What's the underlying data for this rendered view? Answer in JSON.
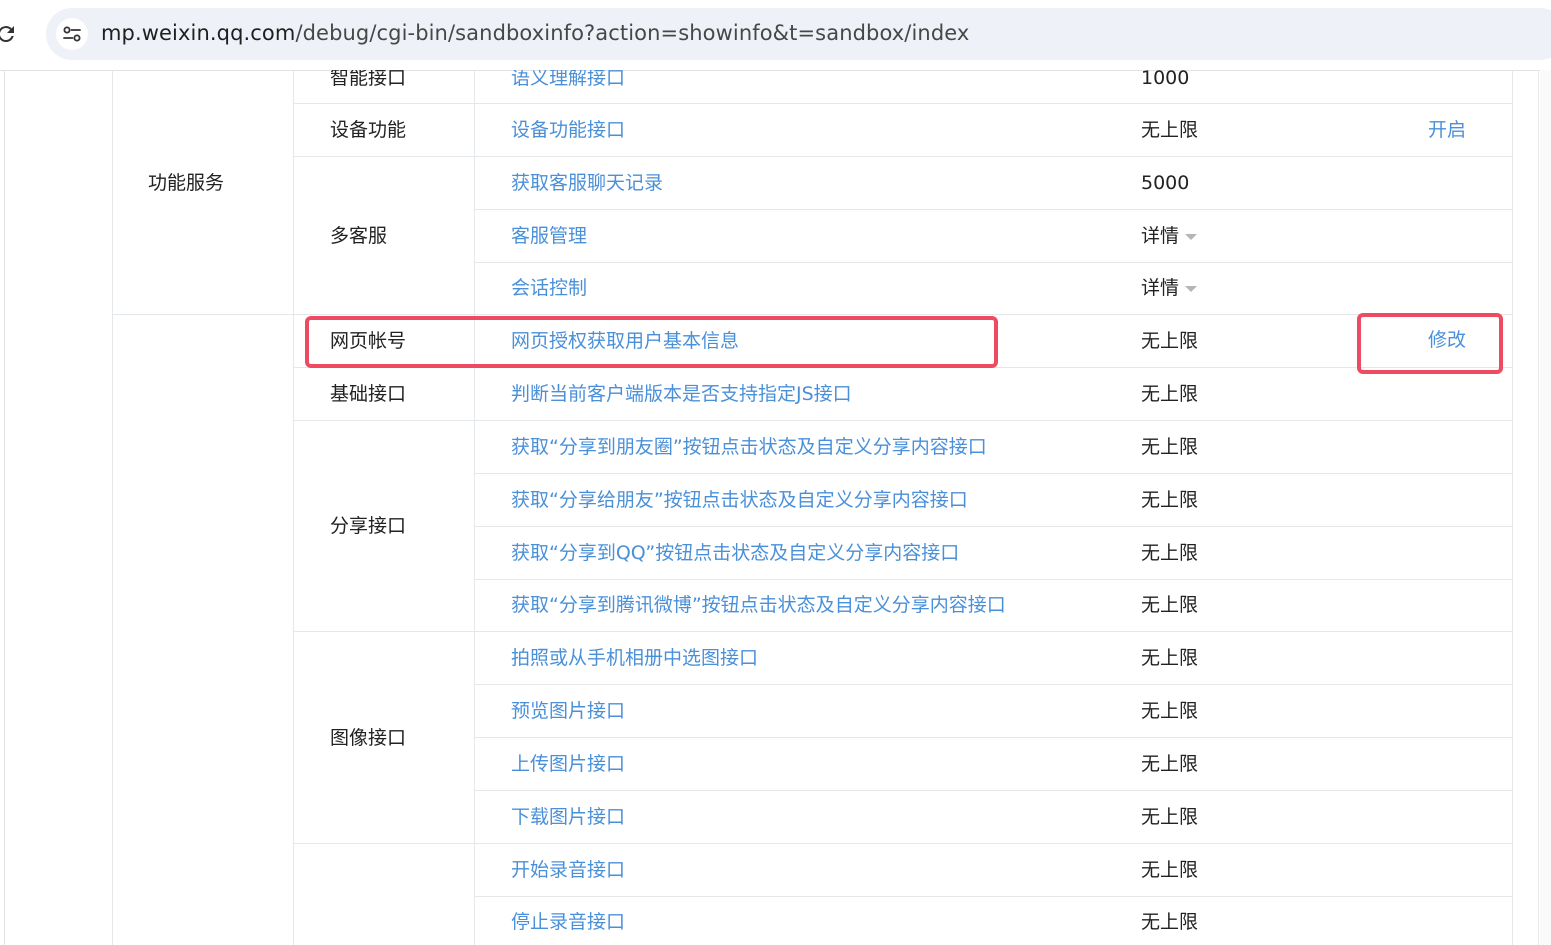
{
  "browser": {
    "url_host": "mp.weixin.qq.com",
    "url_path": "/debug/cgi-bin/sandboxinfo?action=showinfo&t=sandbox/index"
  },
  "table": {
    "rows": [
      {
        "group": "智能接口",
        "interface": "语义理解接口",
        "quota": "1000",
        "action": ""
      },
      {
        "group": "设备功能",
        "interface": "设备功能接口",
        "quota": "无上限",
        "action": "开启"
      },
      {
        "group": "",
        "interface": "获取客服聊天记录",
        "quota": "5000",
        "action": ""
      },
      {
        "group": "多客服",
        "interface": "客服管理",
        "quota": "详情",
        "action": ""
      },
      {
        "group": "",
        "interface": "会话控制",
        "quota": "详情",
        "action": ""
      },
      {
        "group": "网页帐号",
        "interface": "网页授权获取用户基本信息",
        "quota": "无上限",
        "action": "修改"
      },
      {
        "group": "基础接口",
        "interface": "判断当前客户端版本是否支持指定JS接口",
        "quota": "无上限",
        "action": ""
      },
      {
        "group": "",
        "interface": "获取“分享到朋友圈”按钮点击状态及自定义分享内容接口",
        "quota": "无上限",
        "action": ""
      },
      {
        "group": "",
        "interface": "获取“分享给朋友”按钮点击状态及自定义分享内容接口",
        "quota": "无上限",
        "action": ""
      },
      {
        "group": "分享接口",
        "interface": "获取“分享到QQ”按钮点击状态及自定义分享内容接口",
        "quota": "无上限",
        "action": ""
      },
      {
        "group": "",
        "interface": "获取“分享到腾讯微博”按钮点击状态及自定义分享内容接口",
        "quota": "无上限",
        "action": ""
      },
      {
        "group": "",
        "interface": "拍照或从手机相册中选图接口",
        "quota": "无上限",
        "action": ""
      },
      {
        "group": "图像接口",
        "interface": "预览图片接口",
        "quota": "无上限",
        "action": ""
      },
      {
        "group": "",
        "interface": "上传图片接口",
        "quota": "无上限",
        "action": ""
      },
      {
        "group": "",
        "interface": "下载图片接口",
        "quota": "无上限",
        "action": ""
      },
      {
        "group": "",
        "interface": "开始录音接口",
        "quota": "无上限",
        "action": ""
      },
      {
        "group": "",
        "interface": "停止录音接口",
        "quota": "无上限",
        "action": ""
      }
    ],
    "category_function_service": "功能服务"
  },
  "highlight_color": "#ee4b62",
  "link_color": "#4a90d9",
  "icons": {
    "reload": "reload-icon",
    "site_info": "tune-icon",
    "dropdown": "caret-down-icon"
  }
}
